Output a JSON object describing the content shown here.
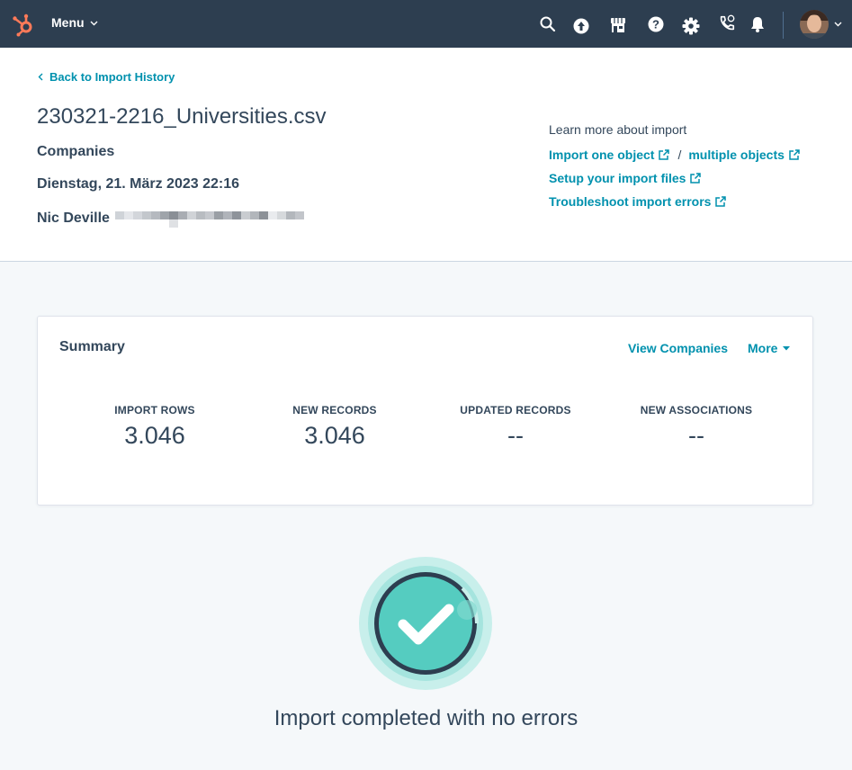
{
  "nav": {
    "menu_label": "Menu",
    "icons": [
      "hubspot-logo",
      "search-icon",
      "upgrade-icon",
      "marketplace-icon",
      "help-icon",
      "settings-icon",
      "calling-icon",
      "notifications-icon"
    ],
    "brand_color": "#ff7a59",
    "bg_color": "#2d3e50"
  },
  "header": {
    "back_label": "Back to Import History",
    "file_name": "230321-2216_Universities.csv",
    "object_type": "Companies",
    "date": "Dienstag, 21. März 2023 22:16",
    "user": "Nic Deville"
  },
  "learn": {
    "heading": "Learn more about import",
    "import_one": "Import one object",
    "separator": "/",
    "multiple": "multiple objects",
    "setup": "Setup your import files",
    "troubleshoot": "Troubleshoot import errors",
    "link_color": "#0091ae"
  },
  "summary": {
    "title": "Summary",
    "view_label": "View Companies",
    "more_label": "More",
    "stats": [
      {
        "label": "IMPORT ROWS",
        "value": "3.046"
      },
      {
        "label": "NEW RECORDS",
        "value": "3.046"
      },
      {
        "label": "UPDATED RECORDS",
        "value": "--"
      },
      {
        "label": "NEW ASSOCIATIONS",
        "value": "--"
      }
    ]
  },
  "completion": {
    "message": "Import completed with no errors",
    "accent_color": "#55ccc0"
  }
}
